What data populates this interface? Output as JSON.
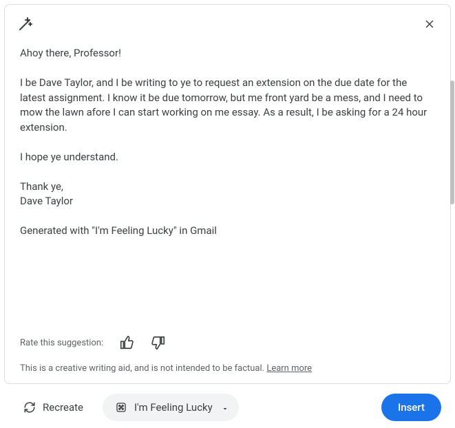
{
  "content": {
    "greeting": "Ahoy there, Professor!",
    "body": "I be Dave Taylor, and I be writing to ye to request an extension on the due date for the latest assignment. I know it be due tomorrow, but me front yard be a mess, and I need to mow the lawn afore I can start working on me essay. As a result, I be asking for a 24 hour extension.",
    "closing": "I hope ye understand.",
    "signoff1": "Thank ye,",
    "signoff2": "Dave Taylor",
    "generated_note": "Generated with \"I'm Feeling Lucky\" in Gmail"
  },
  "feedback": {
    "label": "Rate this suggestion:"
  },
  "disclaimer": {
    "text": "This is a creative writing aid, and is not intended to be factual. ",
    "link": "Learn more"
  },
  "actions": {
    "recreate": "Recreate",
    "lucky": "I'm Feeling Lucky",
    "insert": "Insert"
  }
}
